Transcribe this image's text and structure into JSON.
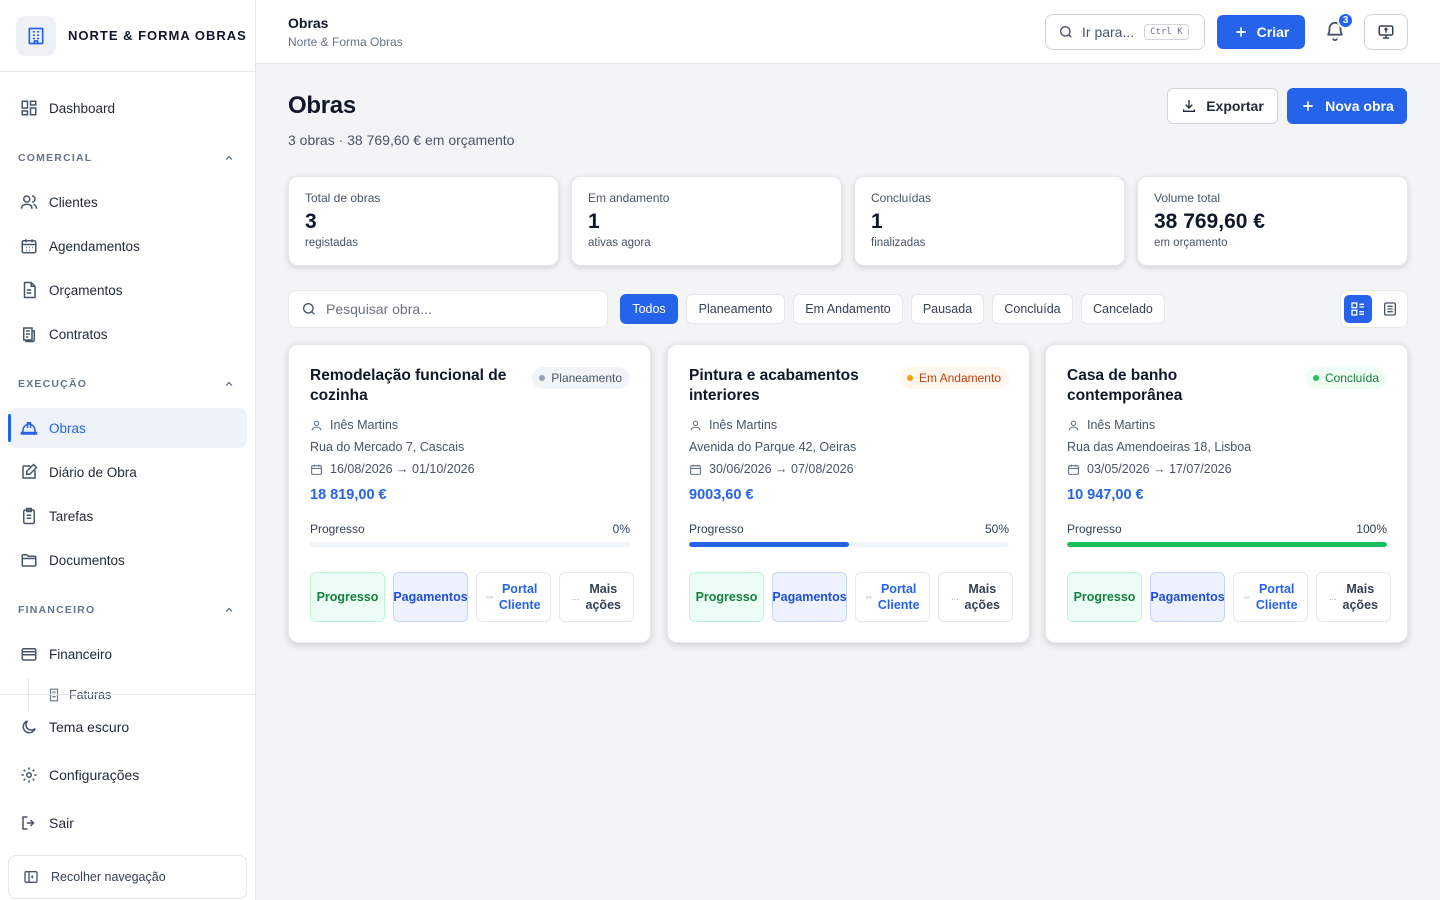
{
  "brand": {
    "name": "NORTE & FORMA OBRAS"
  },
  "sidebar": {
    "dashboard": "Dashboard",
    "sections": {
      "comercial": "COMERCIAL",
      "execucao": "EXECUÇÃO",
      "financeiro": "FINANCEIRO"
    },
    "items": {
      "clientes": "Clientes",
      "agendamentos": "Agendamentos",
      "orcamentos": "Orçamentos",
      "contratos": "Contratos",
      "obras": "Obras",
      "diario": "Diário de Obra",
      "tarefas": "Tarefas",
      "documentos": "Documentos",
      "financeiro": "Financeiro",
      "faturas": "Faturas"
    },
    "bottom": {
      "tema": "Tema escuro",
      "config": "Configurações",
      "sair": "Sair",
      "recolher": "Recolher navegação"
    }
  },
  "header": {
    "title": "Obras",
    "subtitle": "Norte & Forma Obras",
    "goto_label": "Ir para...",
    "goto_shortcut": "Ctrl K",
    "create_label": "Criar",
    "notifications_count": "3"
  },
  "page": {
    "title": "Obras",
    "subtitle": "3 obras · 38 769,60 € em orçamento",
    "export_label": "Exportar",
    "new_label": "Nova obra"
  },
  "stats": [
    {
      "label": "Total de obras",
      "value": "3",
      "hint": "registadas"
    },
    {
      "label": "Em andamento",
      "value": "1",
      "hint": "ativas agora"
    },
    {
      "label": "Concluídas",
      "value": "1",
      "hint": "finalizadas"
    },
    {
      "label": "Volume total",
      "value": "38 769,60 €",
      "hint": "em orçamento"
    }
  ],
  "search": {
    "placeholder": "Pesquisar obra..."
  },
  "filters": [
    "Todos",
    "Planeamento",
    "Em Andamento",
    "Pausada",
    "Concluída",
    "Cancelado"
  ],
  "active_filter": "Todos",
  "view_mode": "grid",
  "progress_label": "Progresso",
  "actions": {
    "progress": "Progresso",
    "payments": "Pagamentos",
    "portal_1": "Portal",
    "portal_2": "Cliente",
    "more_1": "Mais",
    "more_2": "ações",
    "more_prefix": "...",
    "portal_prefix": "◦◦"
  },
  "projects": [
    {
      "title": "Remodelação funcional de cozinha",
      "status": "Planeamento",
      "client": "Inês Martins",
      "address": "Rua do Mercado 7, Cascais",
      "dates": "16/08/2026 → 01/10/2026",
      "price": "18 819,00 €",
      "progress_text": "0%",
      "progress": 0,
      "progress_color": "#2563eb"
    },
    {
      "title": "Pintura e acabamentos interiores",
      "status": "Em Andamento",
      "client": "Inês Martins",
      "address": "Avenida do Parque 42, Oeiras",
      "dates": "30/06/2026 → 07/08/2026",
      "price": "9003,60 €",
      "progress_text": "50%",
      "progress": 50,
      "progress_color": "#2563eb"
    },
    {
      "title": "Casa de banho contemporânea",
      "status": "Concluída",
      "client": "Inês Martins",
      "address": "Rua das Amendoeiras 18, Lisboa",
      "dates": "03/05/2026 → 17/07/2026",
      "price": "10 947,00 €",
      "progress_text": "100%",
      "progress": 100,
      "progress_color": "#16c060"
    }
  ],
  "colors": {
    "accent": "#2563eb",
    "success": "#16c060",
    "warning": "#f59e0b"
  }
}
